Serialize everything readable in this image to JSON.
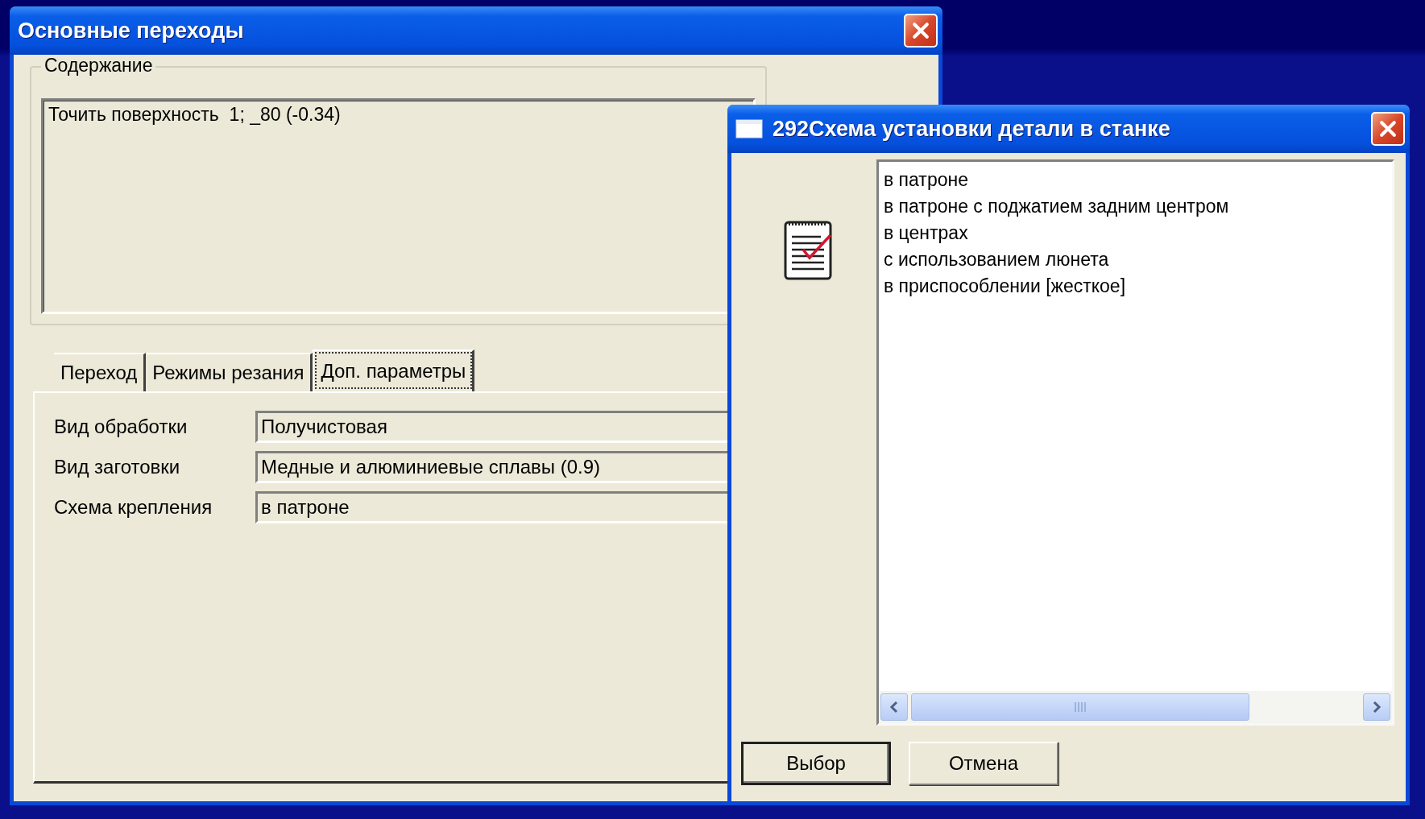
{
  "main_window": {
    "title": "Основные переходы",
    "content_group": {
      "legend": "Содержание",
      "text": "Точить поверхность  1; _80 (-0.34)"
    },
    "tabs": [
      {
        "label": "Переход",
        "selected": false
      },
      {
        "label": "Режимы резания",
        "selected": false
      },
      {
        "label": "Доп. параметры",
        "selected": true
      }
    ],
    "fields": [
      {
        "label": "Вид обработки",
        "value": "Получистовая"
      },
      {
        "label": "Вид заготовки",
        "value": "Медные и алюминиевые сплавы (0.9)"
      },
      {
        "label": "Схема крепления",
        "value": "в патроне"
      }
    ]
  },
  "dialog": {
    "title": "292Схема установки детали в станке",
    "items": [
      "в патроне",
      "в патроне с поджатием задним центром",
      "в центрах",
      "с использованием люнета",
      "в приспособлении [жесткое]"
    ],
    "buttons": [
      {
        "label": "Выбор",
        "default": true
      },
      {
        "label": "Отмена",
        "default": false
      }
    ]
  }
}
